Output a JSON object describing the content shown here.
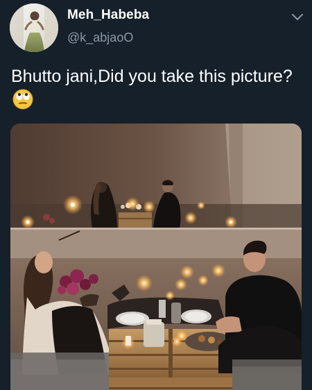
{
  "tweet": {
    "author": {
      "display_name": "Meh_Habeba",
      "handle": "@k_abjaoO",
      "avatar_icon": "avatar"
    },
    "text": "Bhutto jani,Did you take this picture?",
    "text_emoji": "face-with-rolling-eyes",
    "menu_icon": "chevron-down-icon",
    "media": {
      "type": "photo",
      "description_icon": "candlelit-dinner-photo"
    }
  },
  "colors": {
    "background": "#15202b",
    "primary_text": "#ffffff",
    "secondary_text": "#8b98a5"
  }
}
